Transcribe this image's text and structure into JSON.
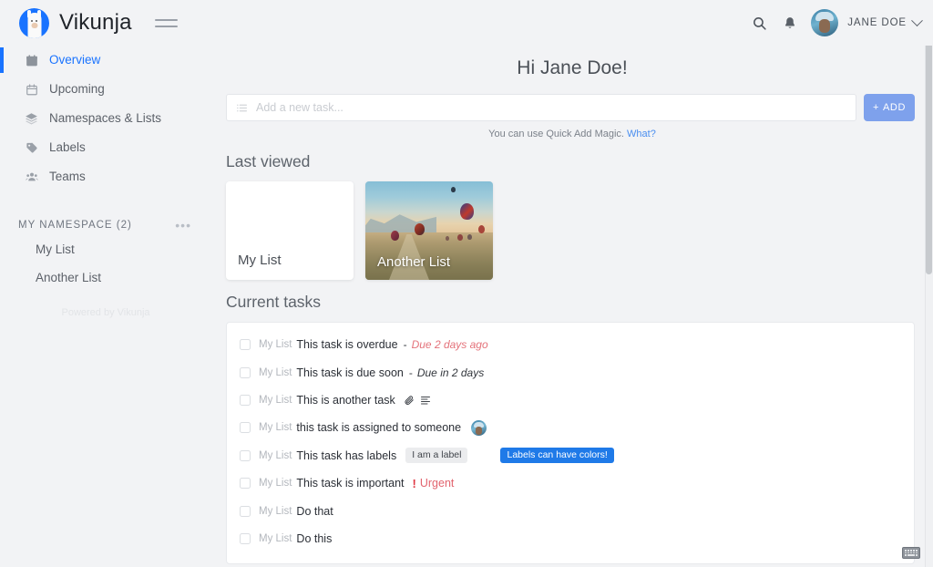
{
  "app": {
    "brand": "Vikunja",
    "logo_icon": "vikunja-llama-logo",
    "menu_icon": "hamburger-menu-icon",
    "accent_color": "#1973ff"
  },
  "topbar": {
    "search_icon": "search-icon",
    "notifications_icon": "bell-icon",
    "avatar": "user-avatar",
    "user_name": "JANE DOE",
    "chevron_icon": "chevron-down-icon"
  },
  "sidebar": {
    "items": [
      {
        "label": "Overview",
        "icon": "calendar-filled-icon",
        "active": true
      },
      {
        "label": "Upcoming",
        "icon": "calendar-outline-icon",
        "active": false
      },
      {
        "label": "Namespaces & Lists",
        "icon": "layers-icon",
        "active": false
      },
      {
        "label": "Labels",
        "icon": "tag-icon",
        "active": false
      },
      {
        "label": "Teams",
        "icon": "users-icon",
        "active": false
      }
    ],
    "namespace": {
      "title": "MY NAMESPACE (2)",
      "menu_icon": "ellipsis-icon",
      "lists": [
        {
          "label": "My List"
        },
        {
          "label": "Another List"
        }
      ]
    },
    "footer": "Powered by Vikunja"
  },
  "main": {
    "greeting": "Hi Jane Doe!",
    "quick_add": {
      "icon": "task-list-icon",
      "placeholder": "Add a new task...",
      "add_label": "ADD",
      "add_plus": "+",
      "hint_text": "You can use Quick Add Magic.",
      "hint_link": "What?"
    },
    "last_viewed": {
      "title": "Last viewed",
      "cards": [
        {
          "title": "My List",
          "style": "plain"
        },
        {
          "title": "Another List",
          "style": "photo-balloons"
        }
      ]
    },
    "current_tasks": {
      "title": "Current tasks",
      "tasks": [
        {
          "list": "My List",
          "title": "This task is overdue",
          "due_separator": "-",
          "due": "Due 2 days ago",
          "due_state": "overdue"
        },
        {
          "list": "My List",
          "title": "This task is due soon",
          "due_separator": "-",
          "due": "Due in 2 days",
          "due_state": "soon"
        },
        {
          "list": "My List",
          "title": "This is another task",
          "icons": [
            "paperclip-icon",
            "description-icon"
          ]
        },
        {
          "list": "My List",
          "title": "this task is assigned to someone",
          "assignee": "assignee-avatar"
        },
        {
          "list": "My List",
          "title": "This task has labels",
          "labels": [
            {
              "text": "I am a label",
              "bg": "#ebecee",
              "color": "#41454b"
            },
            {
              "text": "Labels can have colors!",
              "bg": "#1f7ae8",
              "color": "#ffffff"
            }
          ]
        },
        {
          "list": "My List",
          "title": "This task is important",
          "priority_mark": "!",
          "priority": "Urgent",
          "priority_color": "#e2646e"
        },
        {
          "list": "My List",
          "title": "Do that"
        },
        {
          "list": "My List",
          "title": "Do this"
        }
      ]
    }
  },
  "overlays": {
    "keyboard_icon": "keyboard-icon",
    "scrollbar": "vertical-scrollbar"
  }
}
